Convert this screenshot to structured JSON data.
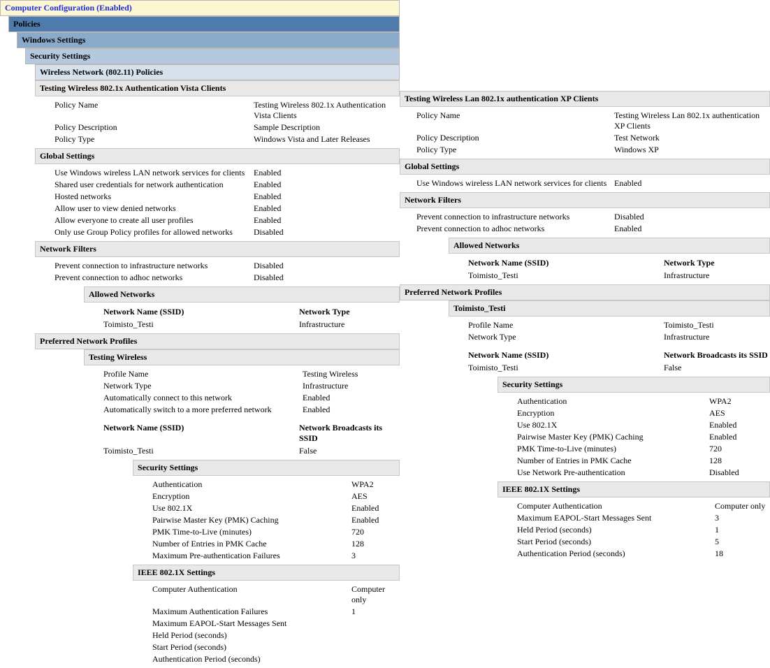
{
  "header": {
    "title": "Computer Configuration (Enabled)",
    "level1": "Policies",
    "level2": "Windows Settings",
    "level3": "Security Settings",
    "level4": "Wireless Network (802.11) Policies"
  },
  "left": {
    "policy_title": "Testing Wireless 802.1x Authentication Vista Clients",
    "basic": {
      "labels": {
        "name": "Policy Name",
        "desc": "Policy Description",
        "type": "Policy Type"
      },
      "name": "Testing Wireless 802.1x Authentication Vista Clients",
      "desc": "Sample Description",
      "type": "Windows Vista and Later Releases"
    },
    "global_title": "Global Settings",
    "global": [
      {
        "k": "Use Windows wireless LAN network services for clients",
        "v": "Enabled"
      },
      {
        "k": "Shared user credentials for network authentication",
        "v": "Enabled"
      },
      {
        "k": "Hosted networks",
        "v": "Enabled"
      },
      {
        "k": "Allow user to view denied networks",
        "v": "Enabled"
      },
      {
        "k": "Allow everyone to create all user profiles",
        "v": "Enabled"
      },
      {
        "k": "Only use Group Policy profiles for allowed networks",
        "v": "Disabled"
      }
    ],
    "filters_title": "Network Filters",
    "filters": [
      {
        "k": "Prevent connection to infrastructure networks",
        "v": "Disabled"
      },
      {
        "k": "Prevent connection to adhoc networks",
        "v": "Disabled"
      }
    ],
    "allowed_title": "Allowed Networks",
    "allowed_headers": {
      "ssid": "Network Name (SSID)",
      "type": "Network Type"
    },
    "allowed_rows": [
      {
        "ssid": "Toimisto_Testi",
        "type": "Infrastructure"
      }
    ],
    "pref_profiles_title": "Preferred Network Profiles",
    "profile": {
      "title": "Testing Wireless",
      "rows": [
        {
          "k": "Profile Name",
          "v": "Testing Wireless"
        },
        {
          "k": "Network Type",
          "v": "Infrastructure"
        },
        {
          "k": "Automatically connect to this network",
          "v": "Enabled"
        },
        {
          "k": "Automatically switch to a more preferred network",
          "v": "Enabled"
        }
      ],
      "ssid_headers": {
        "ssid": "Network Name (SSID)",
        "bcast": "Network Broadcasts its SSID"
      },
      "ssid_row": {
        "ssid": "Toimisto_Testi",
        "bcast": "False"
      },
      "sec_title": "Security Settings",
      "sec": [
        {
          "k": "Authentication",
          "v": "WPA2"
        },
        {
          "k": "Encryption",
          "v": "AES"
        },
        {
          "k": "Use 802.1X",
          "v": "Enabled"
        },
        {
          "k": "Pairwise Master Key (PMK) Caching",
          "v": "Enabled"
        },
        {
          "k": "PMK Time-to-Live (minutes)",
          "v": "720"
        },
        {
          "k": "Number of Entries in PMK Cache",
          "v": "128"
        },
        {
          "k": "Maximum Pre-authentication Failures",
          "v": "3"
        }
      ],
      "ieee_title": "IEEE 802.1X Settings",
      "ieee": [
        {
          "k": "Computer Authentication",
          "v": "Computer only"
        },
        {
          "k": "Maximum Authentication Failures",
          "v": "1"
        },
        {
          "k": "Maximum EAPOL-Start Messages Sent",
          "v": ""
        },
        {
          "k": "Held Period (seconds)",
          "v": ""
        },
        {
          "k": "Start Period (seconds)",
          "v": ""
        },
        {
          "k": "Authentication Period (seconds)",
          "v": ""
        }
      ]
    }
  },
  "right": {
    "policy_title": "Testing Wireless Lan 802.1x authentication XP Clients",
    "basic": {
      "labels": {
        "name": "Policy Name",
        "desc": "Policy Description",
        "type": "Policy Type"
      },
      "name": "Testing Wireless Lan 802.1x authentication XP Clients",
      "desc": "Test Network",
      "type": "Windows XP"
    },
    "global_title": "Global Settings",
    "global": [
      {
        "k": "Use Windows wireless LAN network services for clients",
        "v": "Enabled"
      }
    ],
    "filters_title": "Network Filters",
    "filters": [
      {
        "k": "Prevent connection to infrastructure networks",
        "v": "Disabled"
      },
      {
        "k": "Prevent connection to adhoc networks",
        "v": "Enabled"
      }
    ],
    "allowed_title": "Allowed Networks",
    "allowed_headers": {
      "ssid": "Network Name (SSID)",
      "type": "Network Type"
    },
    "allowed_rows": [
      {
        "ssid": "Toimisto_Testi",
        "type": "Infrastructure"
      }
    ],
    "pref_profiles_title": "Preferred Network Profiles",
    "profile": {
      "title": "Toimisto_Testi",
      "rows": [
        {
          "k": "Profile Name",
          "v": "Toimisto_Testi"
        },
        {
          "k": "Network Type",
          "v": "Infrastructure"
        }
      ],
      "ssid_headers": {
        "ssid": "Network Name (SSID)",
        "bcast": "Network Broadcasts its SSID"
      },
      "ssid_row": {
        "ssid": "Toimisto_Testi",
        "bcast": "False"
      },
      "sec_title": "Security Settings",
      "sec": [
        {
          "k": "Authentication",
          "v": "WPA2"
        },
        {
          "k": "Encryption",
          "v": "AES"
        },
        {
          "k": "Use 802.1X",
          "v": "Enabled"
        },
        {
          "k": "Pairwise Master Key (PMK) Caching",
          "v": "Enabled"
        },
        {
          "k": "PMK Time-to-Live (minutes)",
          "v": "720"
        },
        {
          "k": "Number of Entries in PMK Cache",
          "v": "128"
        },
        {
          "k": "Use Network Pre-authentication",
          "v": "Disabled"
        }
      ],
      "ieee_title": "IEEE 802.1X Settings",
      "ieee": [
        {
          "k": "Computer Authentication",
          "v": "Computer only"
        },
        {
          "k": "Maximum EAPOL-Start Messages Sent",
          "v": "3"
        },
        {
          "k": "Held Period (seconds)",
          "v": "1"
        },
        {
          "k": "Start Period (seconds)",
          "v": "5"
        },
        {
          "k": "Authentication Period (seconds)",
          "v": "18"
        }
      ]
    }
  }
}
